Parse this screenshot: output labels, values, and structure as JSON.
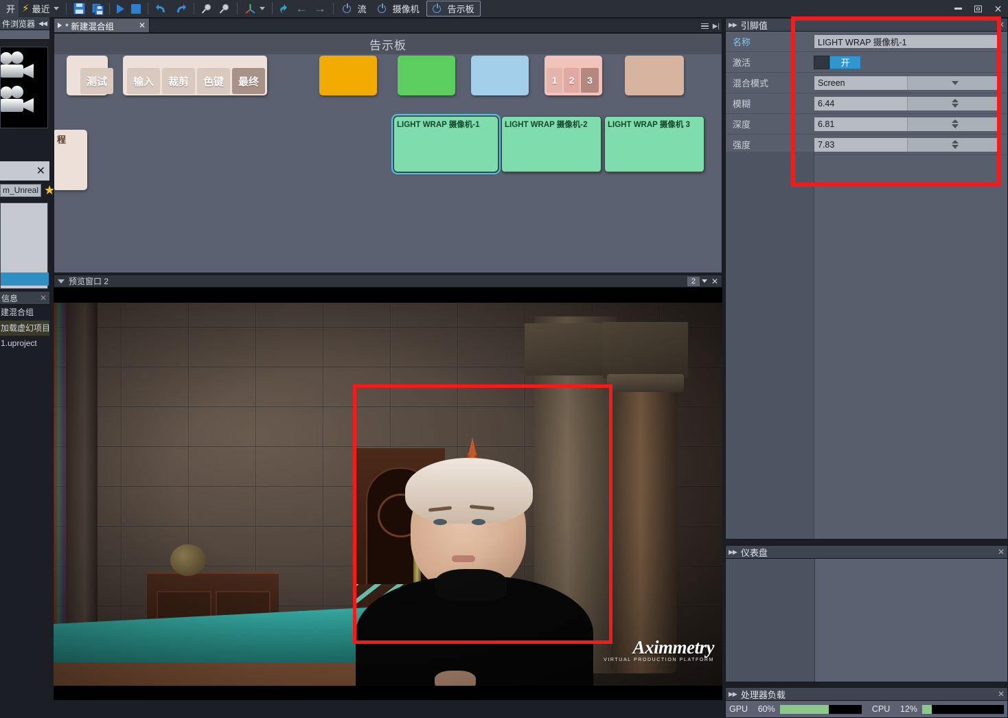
{
  "toolbar": {
    "open_label": "开",
    "recent_label": "最近",
    "items": [
      {
        "name": "save",
        "icon": "floppy-save-icon"
      },
      {
        "name": "save-as",
        "icon": "floppy-save-as-icon"
      },
      {
        "name": "play",
        "icon": "play-icon"
      },
      {
        "name": "stop",
        "icon": "stop-icon"
      },
      {
        "name": "undo",
        "icon": "undo-icon"
      },
      {
        "name": "redo",
        "icon": "redo-icon"
      },
      {
        "name": "zoom-in",
        "icon": "magnifier-icon"
      },
      {
        "name": "zoom-out",
        "icon": "magnifier-icon"
      },
      {
        "name": "axis",
        "icon": "axis-gizmo-icon"
      },
      {
        "name": "up-level",
        "icon": "arrow-up-curve-icon"
      },
      {
        "name": "back",
        "icon": "arrow-left-icon"
      },
      {
        "name": "forward",
        "icon": "arrow-right-icon"
      }
    ],
    "stream_label": "流",
    "camera_label": "摄像机",
    "billboard_label": "告示板"
  },
  "window": {
    "minimize": "–",
    "maximize": "❐",
    "close": "✕"
  },
  "left": {
    "file_browser_title": "件浏览器",
    "favorites_chip": "m_Unreal",
    "info_title": "信息",
    "info_lines": [
      {
        "text": "建混合组",
        "highlight": false
      },
      {
        "text": "加载虚幻项目",
        "highlight": true
      },
      {
        "text": "1.uproject",
        "highlight": false
      }
    ]
  },
  "editor": {
    "tab_label": "* 新建混合组",
    "tab_close": "✕",
    "canvas_title": "告示板",
    "nodes": {
      "test_chip": "测试",
      "stage_chips": [
        "输入",
        "裁剪",
        "色键",
        "最终"
      ],
      "stage_active_index": 3,
      "numbered_chips": [
        "1",
        "2",
        "3"
      ],
      "numbered_active_index": 2,
      "partial_label": "程",
      "lightwrap": [
        {
          "label": "LIGHT WRAP 摄像机-1",
          "selected": true
        },
        {
          "label": "LIGHT WRAP 摄像机-2",
          "selected": false
        },
        {
          "label": "LIGHT WRAP 摄像机 3",
          "selected": false
        }
      ],
      "colors": {
        "yellow": "#f2ab00",
        "green": "#5bce5f",
        "blue": "#a3cfeb",
        "pink": "#f1c3bb",
        "pink_dark": "#b5887f",
        "tan": "#d7b4a0",
        "cream": "#ece0d8",
        "lightwrap": "#7fdcad"
      }
    }
  },
  "preview": {
    "title": "预览窗口 2",
    "index": "2",
    "close": "✕",
    "watermark_name": "Aximmetry",
    "watermark_sub": "VIRTUAL PRODUCTION PLATFORM"
  },
  "right": {
    "pin_values": {
      "title": "引脚值",
      "close": "✕",
      "rows": [
        {
          "label": "名称",
          "type": "text",
          "value": "LIGHT WRAP 摄像机-1",
          "accent": true
        },
        {
          "label": "激活",
          "type": "toggle",
          "value": "开"
        },
        {
          "label": "混合模式",
          "type": "combo",
          "value": "Screen"
        },
        {
          "label": "模糊",
          "type": "spin",
          "value": "6.44"
        },
        {
          "label": "深度",
          "type": "spin",
          "value": "6.81"
        },
        {
          "label": "强度",
          "type": "spin",
          "value": "7.83"
        }
      ]
    },
    "dashboard": {
      "title": "仪表盘",
      "close": "✕"
    },
    "processor_load": {
      "title": "处理器负载",
      "close": "✕",
      "gpu_label": "GPU",
      "gpu_value": "60%",
      "gpu_percent": 60,
      "cpu_label": "CPU",
      "cpu_value": "12%",
      "cpu_percent": 12
    }
  },
  "annotations": {
    "accent_red": "#f71a1a"
  }
}
